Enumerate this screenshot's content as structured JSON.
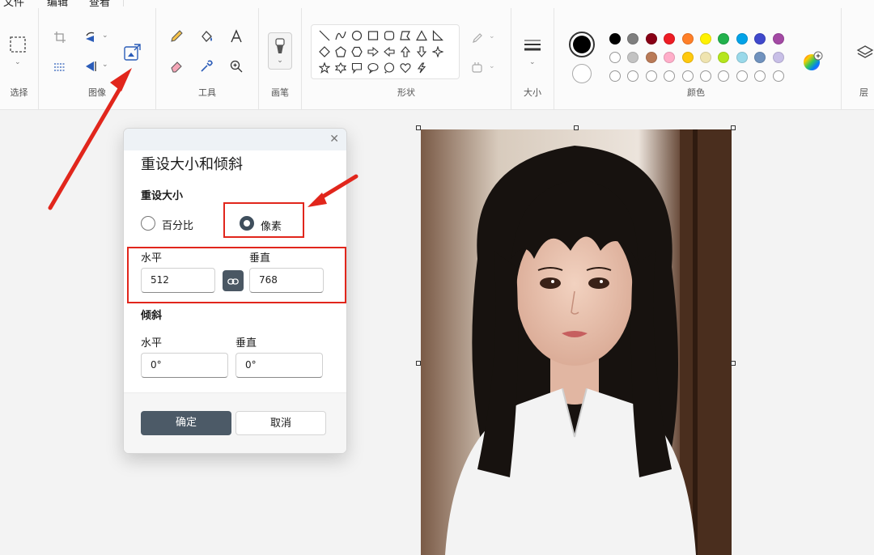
{
  "menu": [
    "文件",
    "编辑",
    "查看"
  ],
  "ribbon": {
    "groups": {
      "select": "选择",
      "image": "图像",
      "tools": "工具",
      "brush": "画笔",
      "shapes": "形状",
      "size": "大小",
      "colors": "颜色",
      "layers": "层"
    },
    "palette_row1": [
      "#000000",
      "#7f7f7f",
      "#880015",
      "#ed1c24",
      "#ff7f27",
      "#fff200",
      "#22b14c",
      "#00a2e8",
      "#3f48cc",
      "#a349a4"
    ],
    "palette_row2": [
      "#ffffff",
      "#c3c3c3",
      "#b97a57",
      "#ffaec9",
      "#ffc90e",
      "#efe4b0",
      "#b5e61d",
      "#99d9ea",
      "#7092be",
      "#c8bfe7"
    ],
    "primary_color": "#000000",
    "secondary_color": "#ffffff"
  },
  "dialog": {
    "title": "重设大小和倾斜",
    "resize_label": "重设大小",
    "options": {
      "percent": "百分比",
      "pixels": "像素"
    },
    "selected_option": "pixels",
    "horizontal_label": "水平",
    "vertical_label": "垂直",
    "resize_horizontal": "512",
    "resize_vertical": "768",
    "skew_label": "倾斜",
    "skew_horizontal": "0°",
    "skew_vertical": "0°",
    "ok": "确定",
    "cancel": "取消"
  }
}
